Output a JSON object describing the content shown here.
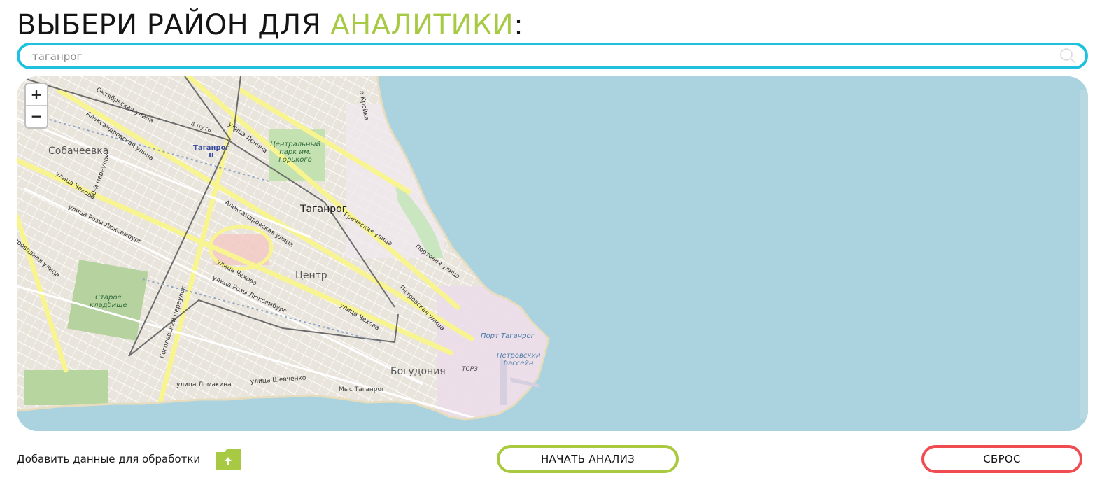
{
  "header": {
    "title_prefix": "ВЫБЕРИ РАЙОН ДЛЯ ",
    "title_accent": "АНАЛИТИКИ",
    "title_suffix": ":"
  },
  "search": {
    "value": "таганрог",
    "placeholder": "",
    "icon": "search-icon"
  },
  "map": {
    "zoom_in": "+",
    "zoom_out": "−",
    "labels": {
      "city": "Таганрог",
      "sobacheevka": "Собачеевка",
      "center": "Центр",
      "bogudonia": "Богудония",
      "park_l1": "Центральный",
      "park_l2": "парк им.",
      "park_l3": "Горького",
      "cemetery_l1": "Старое",
      "cemetery_l2": "кладбище",
      "station_l1": "Таганрог",
      "station_l2": "II",
      "port": "Порт Таганрог",
      "basin_l1": "Петровский",
      "basin_l2": "бассейн",
      "tsrz": "ТСРЗ",
      "cape": "Мыс Таганрог",
      "put": "4 путь",
      "oktyabrskaya": "Октябрьская улица",
      "aleksandrovskaya1": "Александровская улица",
      "aleksandrovskaya2": "Александровская улица",
      "chekhova1": "улица Чехова",
      "chekhova2": "улица Чехова",
      "chekhova3": "улица Чехова",
      "luxemburg1": "улица Розы Люксембург",
      "luxemburg2": "улица Розы Люксембург",
      "lenina": "улица Ленина",
      "grecheskaya": "Греческая улица",
      "portovaya": "Портовая улица",
      "petrovskaya": "Петровская улица",
      "gogolevsky": "Гоголевский переулок",
      "pereulok10": "10-й переулок",
      "lomakina": "улица Ломакина",
      "shevchenko": "улица Шевченко",
      "vodnaya": "-проводная улица",
      "kroyka": "а Кройка"
    }
  },
  "actions": {
    "add_data_label": "Добавить данные для обработки",
    "upload_icon": "upload-folder-icon",
    "start_label": "НАЧАТЬ АНАЛИЗ",
    "reset_label": "СБРОС"
  },
  "colors": {
    "accent_green": "#a7c944",
    "search_border": "#1ec2df",
    "start_border": "#a9c93e",
    "reset_border": "#ef4b50",
    "water": "#aad3df",
    "land": "#f2efe9"
  }
}
